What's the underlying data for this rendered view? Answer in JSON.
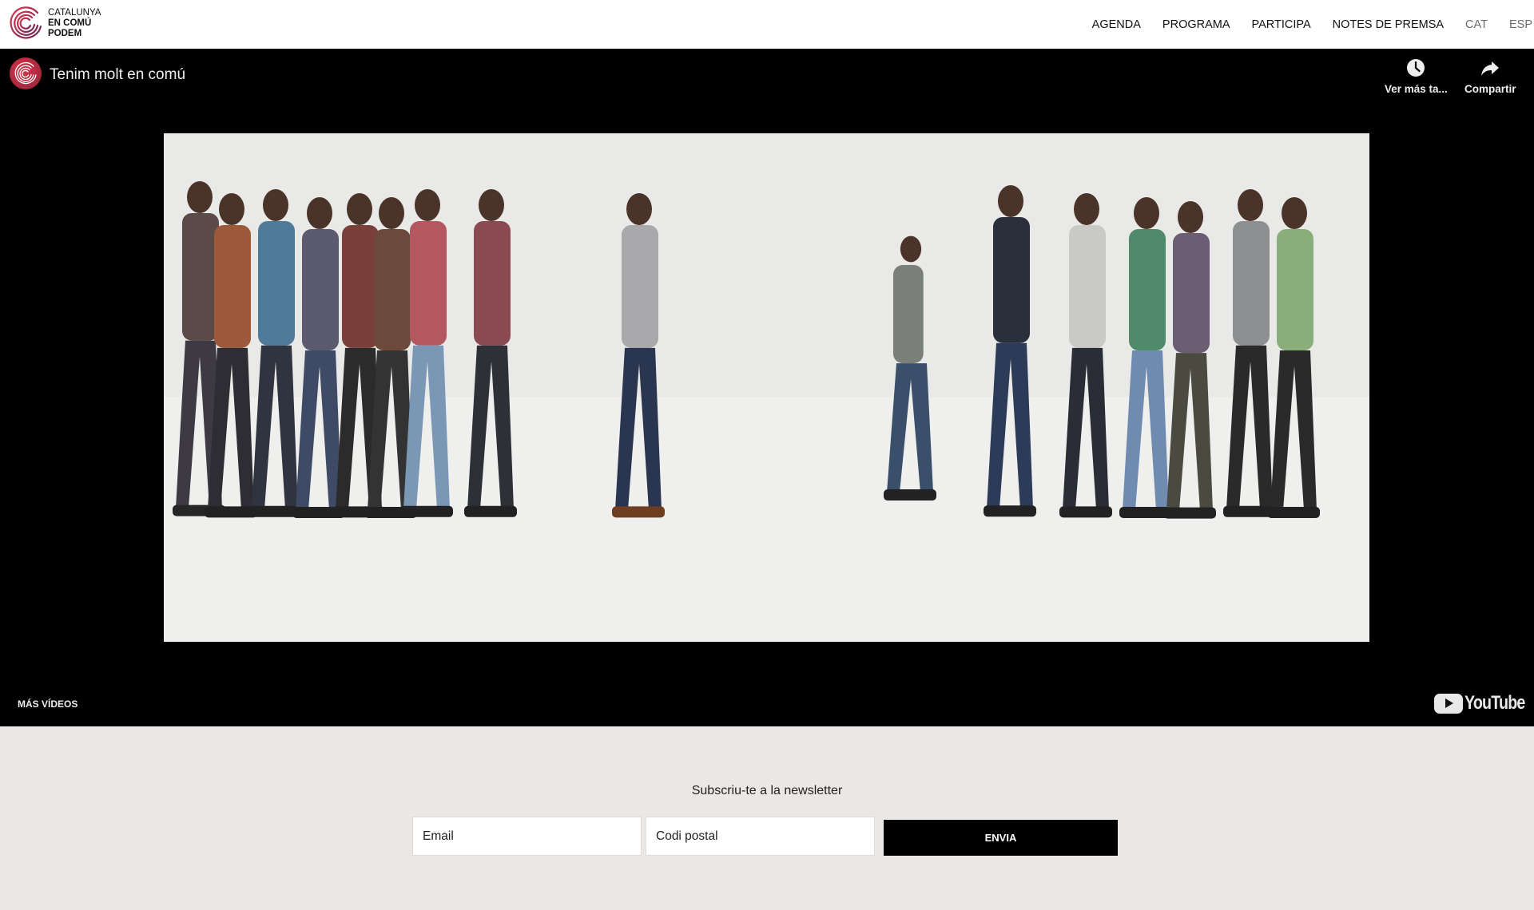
{
  "header": {
    "logo": {
      "line1": "CATALUNYA",
      "line2": "EN COMÚ",
      "line3": "PODEM",
      "icon": "concentric-circles-logo",
      "colors": [
        "#c8304a",
        "#7a2a55"
      ]
    },
    "nav": [
      {
        "label": "AGENDA"
      },
      {
        "label": "PROGRAMA"
      },
      {
        "label": "PARTICIPA"
      },
      {
        "label": "NOTES DE PREMSA"
      },
      {
        "label": "CAT"
      },
      {
        "label": "ESP"
      }
    ]
  },
  "video": {
    "title": "Tenim molt en comú",
    "channel_icon": "channel-logo",
    "actions": [
      {
        "label": "Ver más ta...",
        "icon": "clock-icon"
      },
      {
        "label": "Compartir",
        "icon": "share-arrow-icon"
      }
    ],
    "more_videos": "MÁS VÍDEOS",
    "brand": "YouTube",
    "thumbnail_description": "People walking across a white studio floor"
  },
  "newsletter": {
    "title": "Subscriu-te a la newsletter",
    "email_placeholder": "Email",
    "postal_placeholder": "Codi postal",
    "submit_label": "ENVIA"
  },
  "colors": {
    "background": "#ebe7e5",
    "video_bg": "#000000",
    "button_bg": "#000000",
    "brand_red": "#c8304a"
  }
}
